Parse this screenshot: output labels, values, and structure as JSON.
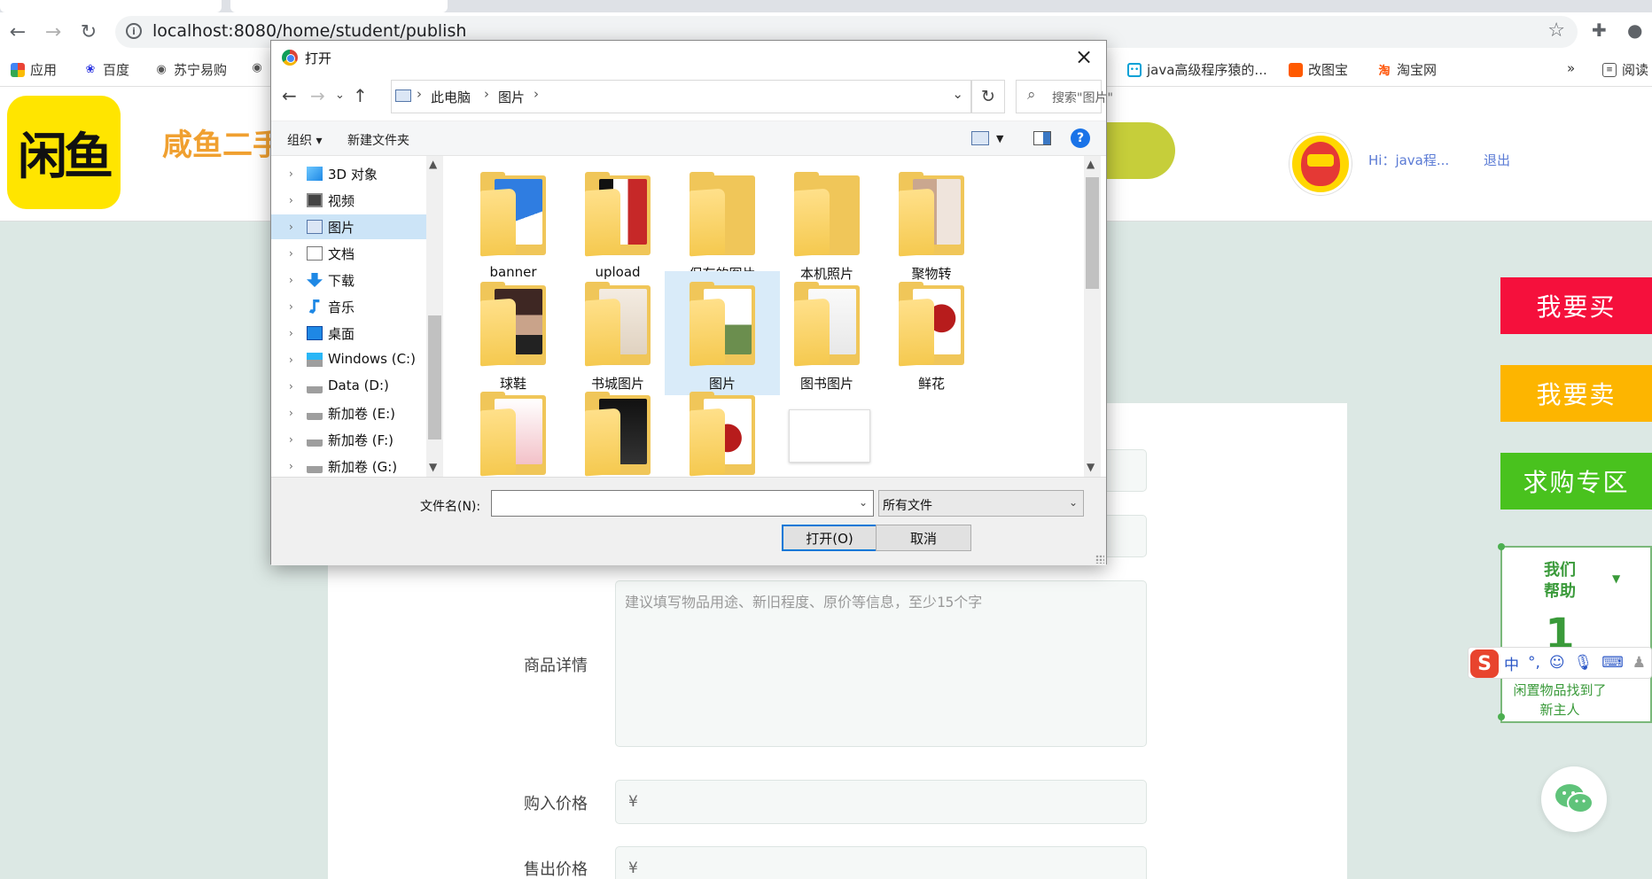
{
  "browser": {
    "url": "localhost:8080/home/student/publish",
    "bookmarks": [
      {
        "label": "应用",
        "icon": "apps-grid-icon"
      },
      {
        "label": "百度",
        "icon": "baidu-paw-icon"
      },
      {
        "label": "苏宁易购",
        "icon": "globe-icon"
      },
      {
        "label": "java高级程序猿的...",
        "icon": "bilibili-icon"
      },
      {
        "label": "改图宝",
        "icon": "orange-square-icon"
      },
      {
        "label": "淘宝网",
        "icon": "taobao-icon"
      }
    ],
    "more": "»",
    "reading_list": "阅读"
  },
  "site": {
    "logo_text": "闲鱼",
    "name": "咸鱼二手",
    "greeting": "Hi：java程...",
    "logout": "退出"
  },
  "side_buttons": [
    {
      "label": "我要买",
      "color": "#f5103c"
    },
    {
      "label": "我要卖",
      "color": "#fdb500"
    },
    {
      "label": "求购专区",
      "color": "#49c21e"
    }
  ],
  "help_widget": {
    "line1": "我们",
    "line2": "帮助",
    "number": "1",
    "line3": "闲置物品找到了",
    "line4": "新主人"
  },
  "ime": {
    "mode": "中"
  },
  "form": {
    "detail_label": "商品详情",
    "detail_placeholder": "建议填写物品用途、新旧程度、原价等信息，至少15个字",
    "buy_price_label": "购入价格",
    "sell_price_label": "售出价格",
    "currency": "¥"
  },
  "dialog": {
    "title": "打开",
    "breadcrumb": [
      "此电脑",
      "图片"
    ],
    "search_placeholder": "搜索\"图片\"",
    "organize": "组织 ▾",
    "new_folder": "新建文件夹",
    "tree": [
      {
        "label": "3D 对象",
        "selected": false
      },
      {
        "label": "视频",
        "selected": false
      },
      {
        "label": "图片",
        "selected": true
      },
      {
        "label": "文档",
        "selected": false
      },
      {
        "label": "下载",
        "selected": false
      },
      {
        "label": "音乐",
        "selected": false
      },
      {
        "label": "桌面",
        "selected": false
      },
      {
        "label": "Windows (C:)",
        "selected": false
      },
      {
        "label": "Data (D:)",
        "selected": false
      },
      {
        "label": "新加卷 (E:)",
        "selected": false
      },
      {
        "label": "新加卷 (F:)",
        "selected": false
      },
      {
        "label": "新加卷 (G:)",
        "selected": false
      }
    ],
    "files": [
      {
        "name": "banner"
      },
      {
        "name": "upload"
      },
      {
        "name": "保存的图片"
      },
      {
        "name": "本机照片"
      },
      {
        "name": "聚物转"
      },
      {
        "name": "球鞋"
      },
      {
        "name": "书城图片"
      },
      {
        "name": "图片"
      },
      {
        "name": "图书图片"
      },
      {
        "name": "鲜花"
      }
    ],
    "filename_label": "文件名(N):",
    "filename_value": "",
    "filetype": "所有文件",
    "open_button": "打开(O)",
    "cancel_button": "取消"
  },
  "colors": {
    "page_bg": "#dce8e4",
    "folder_yellow": "#f0c659",
    "accent_blue": "#0078d7"
  }
}
